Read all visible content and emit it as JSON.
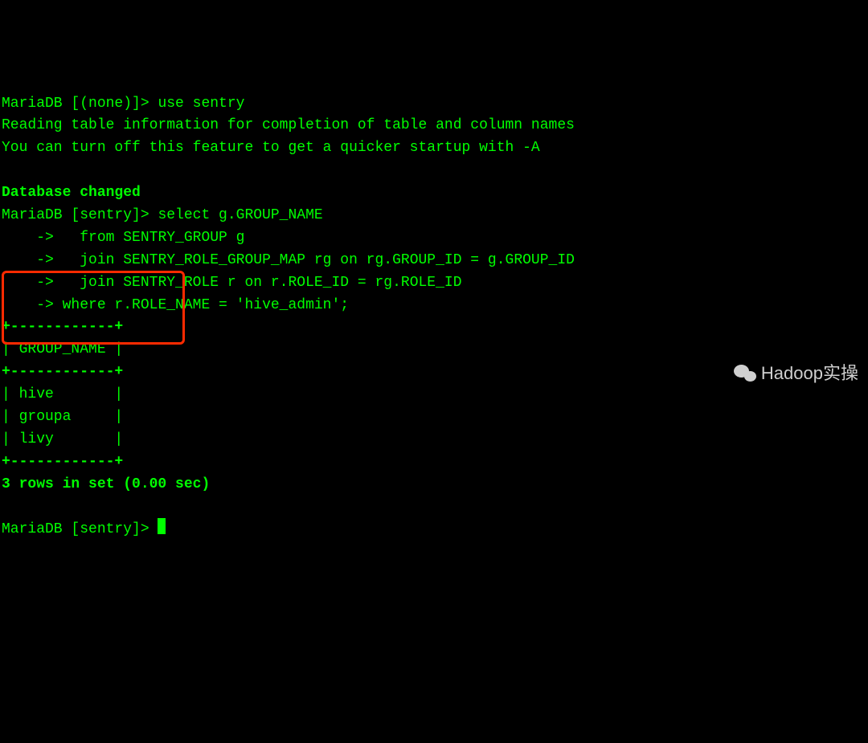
{
  "term": {
    "prompt_none": "MariaDB [(none)]> ",
    "cmd_use": "use sentry",
    "reading1": "Reading table information for completion of table and column names",
    "reading2": "You can turn off this feature to get a quicker startup with -A",
    "blank": "",
    "db_changed": "Database changed",
    "prompt_sentry": "MariaDB [sentry]> ",
    "sel_l1": "select g.GROUP_NAME",
    "cont": "    -> ",
    "sel_l2": "  from SENTRY_GROUP g",
    "sel_l3": "  join SENTRY_ROLE_GROUP_MAP rg on rg.GROUP_ID = g.GROUP_ID",
    "sel_l4": "  join SENTRY_ROLE r on r.ROLE_ID = rg.ROLE_ID",
    "sel_l5": "where r.ROLE_NAME = 'hive_admin';",
    "table_sep": "+------------+",
    "table_header": "| GROUP_NAME |",
    "table_r1": "| hive       |",
    "table_r2": "| groupa     |",
    "table_r3": "| livy       |",
    "rows_in_set": "3 rows in set (0.00 sec)",
    "watermark_text": "Hadoop实操"
  },
  "chart_data": {
    "type": "table",
    "title": "GROUP_NAME",
    "columns": [
      "GROUP_NAME"
    ],
    "rows": [
      [
        "hive"
      ],
      [
        "groupa"
      ],
      [
        "livy"
      ]
    ],
    "summary": "3 rows in set (0.00 sec)"
  }
}
